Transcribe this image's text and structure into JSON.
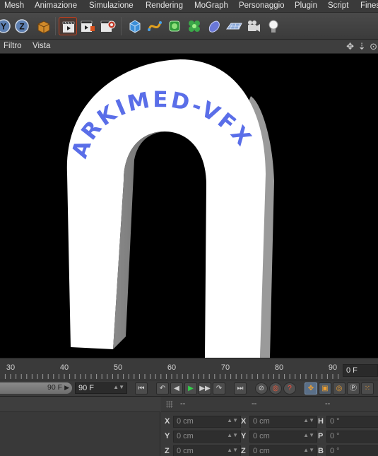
{
  "menu": [
    "Mesh",
    "Animazione",
    "Simulazione",
    "Rendering",
    "MoGraph",
    "Personaggio",
    "Plugin",
    "Script",
    "Finestra"
  ],
  "toolbar": {
    "axis_y_label": "Y",
    "axis_z_label": "Z"
  },
  "viewport": {
    "menu": [
      "Filtro",
      "Vista"
    ],
    "nav_icons": "✥ ⇣ ⊙",
    "arch_text": "ARKIMED-VFX",
    "text_color": "#5a6ee8",
    "background": "#000000",
    "object_color": "#ffffff"
  },
  "timeline": {
    "ticks": [
      "30",
      "40",
      "50",
      "60",
      "70",
      "80",
      "90"
    ],
    "current_frame": "0 F"
  },
  "transport": {
    "slider_value": "90 F",
    "end_frame": "90 F",
    "buttons": [
      "⏮",
      "↶",
      "◀",
      "▶",
      "▶▶",
      "↷",
      "⏭"
    ]
  },
  "coords": {
    "header": [
      "--",
      "--",
      "--"
    ],
    "rows": [
      {
        "pos_label": "X",
        "pos_value": "0 cm",
        "size_label": "X",
        "size_value": "0 cm",
        "rot_label": "H",
        "rot_value": "0 °"
      },
      {
        "pos_label": "Y",
        "pos_value": "0 cm",
        "size_label": "Y",
        "size_value": "0 cm",
        "rot_label": "P",
        "rot_value": "0 °"
      },
      {
        "pos_label": "Z",
        "pos_value": "0 cm",
        "size_label": "Z",
        "size_value": "0 cm",
        "rot_label": "B",
        "rot_value": "0 °"
      }
    ]
  }
}
